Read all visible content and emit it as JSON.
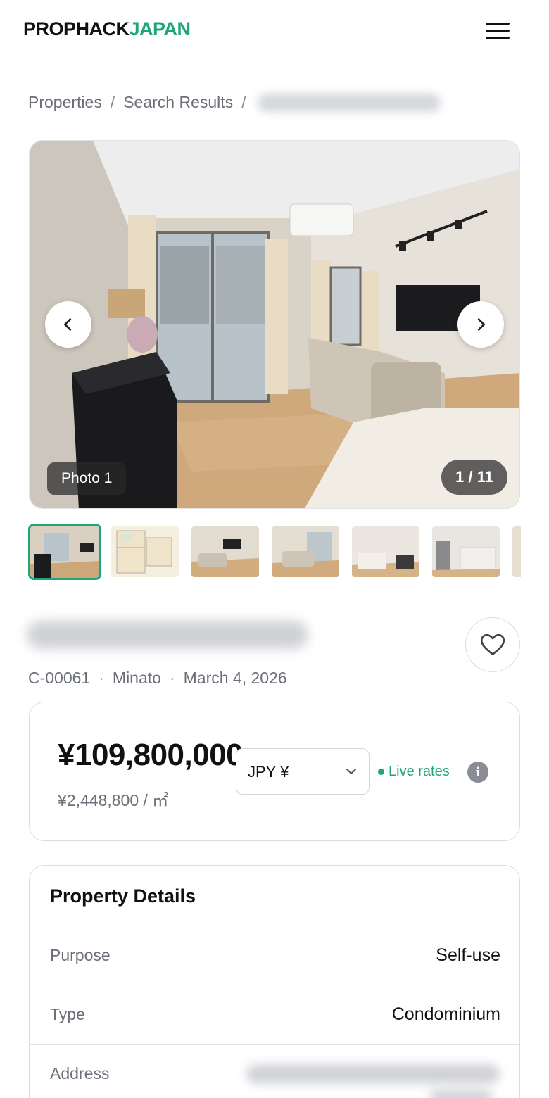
{
  "header": {
    "logo_part1": "PROPHACK",
    "logo_part2": "JAPAN",
    "menu_icon": "hamburger-menu-icon"
  },
  "breadcrumb": {
    "items": [
      "Properties",
      "Search Results"
    ],
    "separator": "/"
  },
  "gallery": {
    "photo_label": "Photo 1",
    "counter": "1 / 11",
    "prev_icon": "chevron-left-icon",
    "next_icon": "chevron-right-icon"
  },
  "property": {
    "id": "C-00061",
    "ward": "Minato",
    "date": "March 4, 2026",
    "favorite_icon": "heart-icon"
  },
  "price": {
    "main": "¥109,800,000",
    "per_sqm": "¥2,448,800 / ㎡",
    "currency": "JPY ¥",
    "live_label": "Live rates"
  },
  "details": {
    "title": "Property Details",
    "rows": [
      {
        "label": "Purpose",
        "value": "Self-use"
      },
      {
        "label": "Type",
        "value": "Condominium"
      },
      {
        "label": "Address",
        "value": ""
      }
    ]
  },
  "colors": {
    "accent": "#1fa57c",
    "text": "#111111",
    "muted": "#6b6f78"
  }
}
